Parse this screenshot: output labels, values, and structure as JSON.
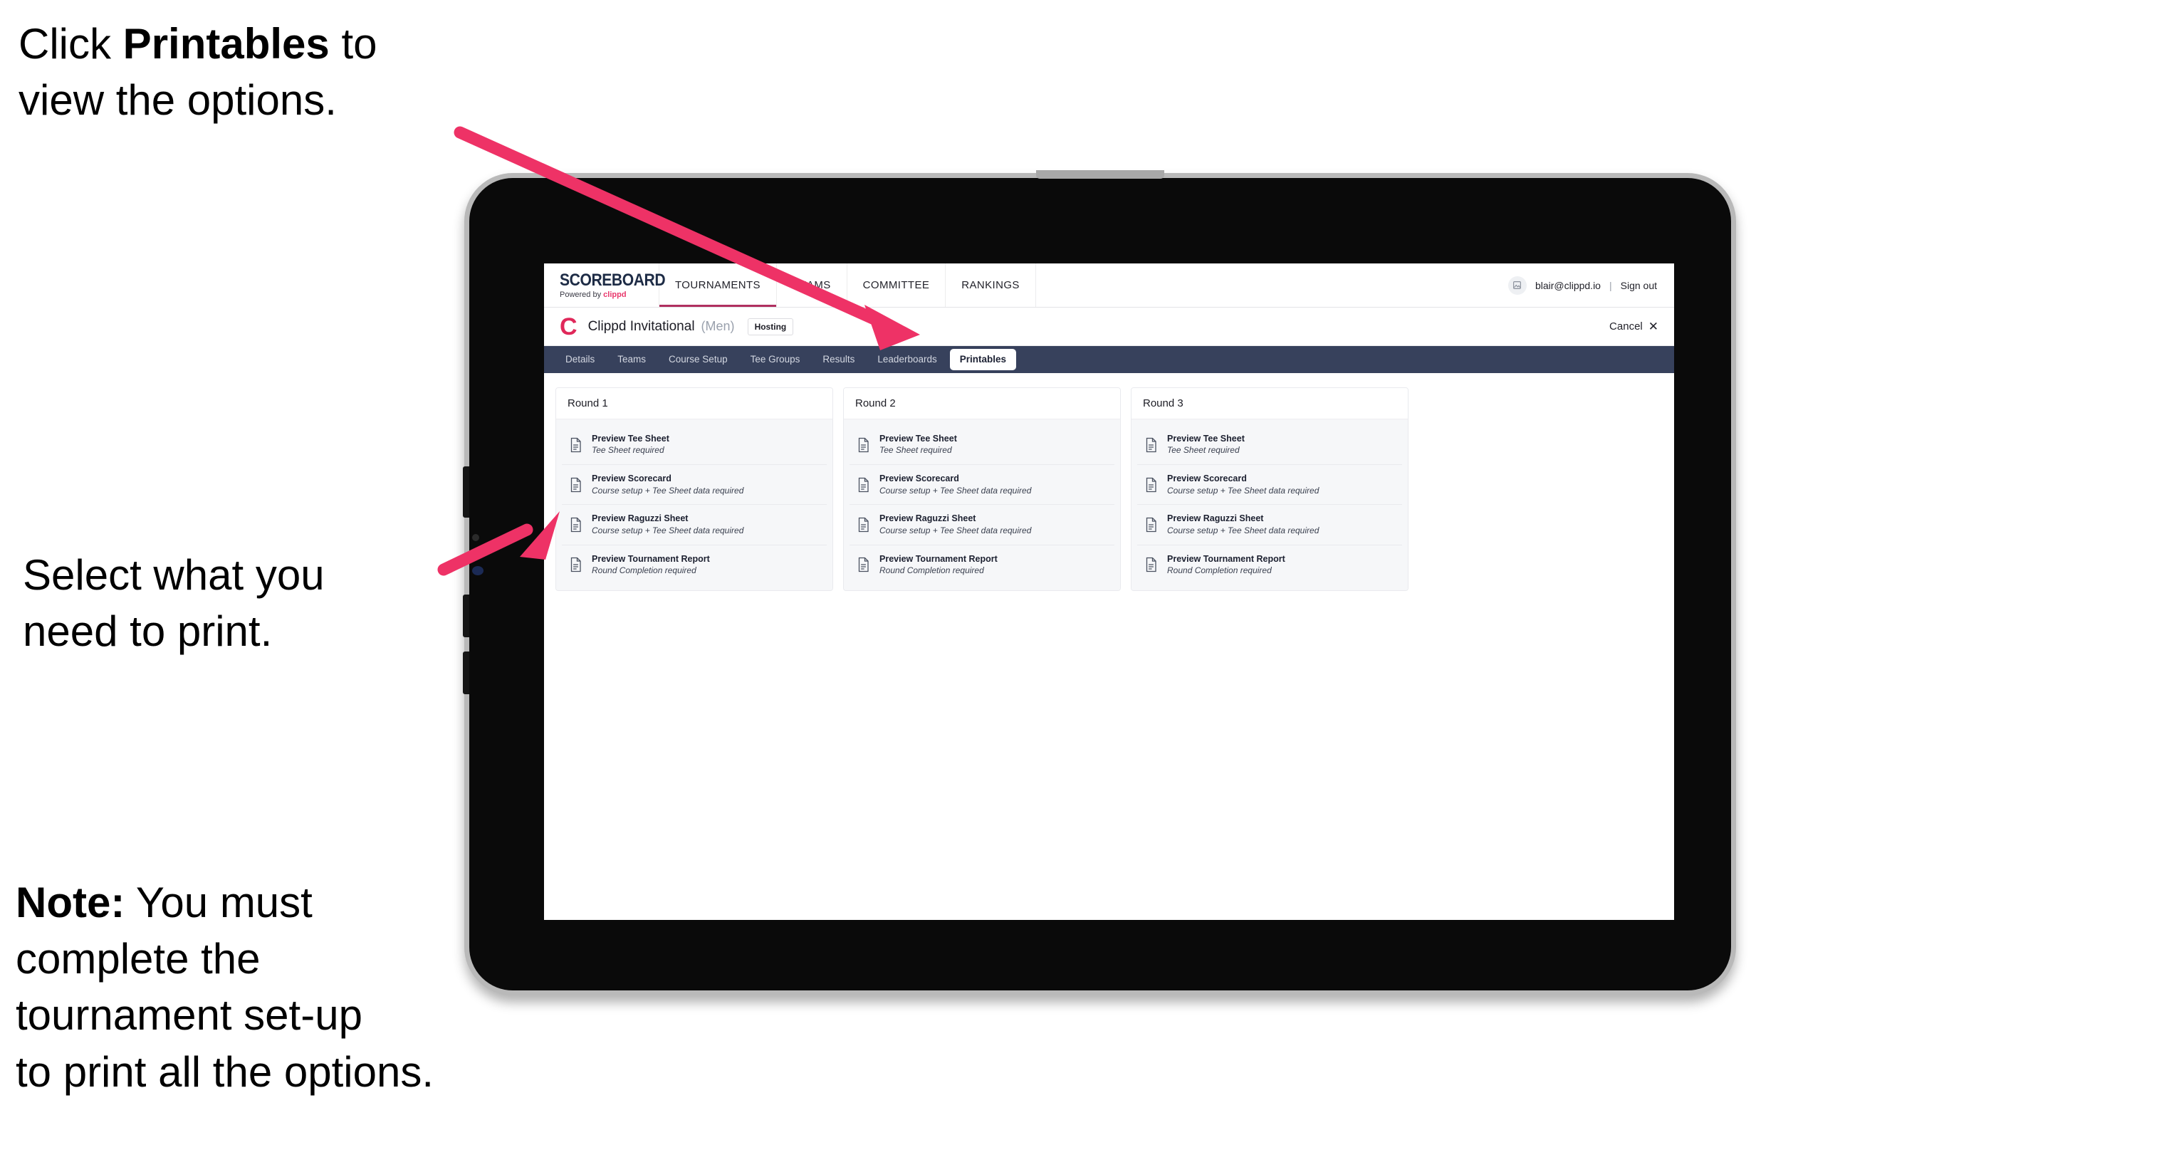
{
  "annotations": {
    "click_printables": "Click Printables to\nview the options.",
    "click_printables_pre": "Click ",
    "click_printables_bold": "Printables",
    "click_printables_post": " to\nview the options.",
    "select_print": "Select what you\n need to print.",
    "note_bold": "Note:",
    "note_rest": " You must\ncomplete the\ntournament set-up\nto print all the options."
  },
  "colors": {
    "arrow_pink": "#EE3266",
    "brand_pink": "#E8376B",
    "clippd_red": "#E0285A",
    "navy": "#1D2B45",
    "subtab_bar": "#37415C",
    "active_underline": "#B03060"
  },
  "topnav": {
    "logo_word": "SCOREBOARD",
    "logo_sub_prefix": "Powered by ",
    "logo_sub_brand": "clippd",
    "items": [
      {
        "label": "TOURNAMENTS",
        "active": true
      },
      {
        "label": "TEAMS",
        "active": false
      },
      {
        "label": "COMMITTEE",
        "active": false
      },
      {
        "label": "RANKINGS",
        "active": false
      }
    ],
    "user": {
      "avatar_icon": "user-avatar-icon",
      "email": "blair@clippd.io",
      "separator": "|",
      "sign_out": "Sign out"
    }
  },
  "tournament_header": {
    "logo_letter": "C",
    "name": "Clippd Invitational",
    "gender": "(Men)",
    "badge": "Hosting",
    "cancel_label": "Cancel",
    "cancel_icon": "close-icon"
  },
  "subtabs": [
    {
      "label": "Details",
      "active": false
    },
    {
      "label": "Teams",
      "active": false
    },
    {
      "label": "Course Setup",
      "active": false
    },
    {
      "label": "Tee Groups",
      "active": false
    },
    {
      "label": "Results",
      "active": false
    },
    {
      "label": "Leaderboards",
      "active": false
    },
    {
      "label": "Printables",
      "active": true
    }
  ],
  "rounds": [
    {
      "title": "Round 1",
      "items": [
        {
          "title": "Preview Tee Sheet",
          "sub": "Tee Sheet required"
        },
        {
          "title": "Preview Scorecard",
          "sub": "Course setup + Tee Sheet data required"
        },
        {
          "title": "Preview Raguzzi Sheet",
          "sub": "Course setup + Tee Sheet data required"
        },
        {
          "title": "Preview Tournament Report",
          "sub": "Round Completion required"
        }
      ]
    },
    {
      "title": "Round 2",
      "items": [
        {
          "title": "Preview Tee Sheet",
          "sub": "Tee Sheet required"
        },
        {
          "title": "Preview Scorecard",
          "sub": "Course setup + Tee Sheet data required"
        },
        {
          "title": "Preview Raguzzi Sheet",
          "sub": "Course setup + Tee Sheet data required"
        },
        {
          "title": "Preview Tournament Report",
          "sub": "Round Completion required"
        }
      ]
    },
    {
      "title": "Round 3",
      "items": [
        {
          "title": "Preview Tee Sheet",
          "sub": "Tee Sheet required"
        },
        {
          "title": "Preview Scorecard",
          "sub": "Course setup + Tee Sheet data required"
        },
        {
          "title": "Preview Raguzzi Sheet",
          "sub": "Course setup + Tee Sheet data required"
        },
        {
          "title": "Preview Tournament Report",
          "sub": "Round Completion required"
        }
      ]
    }
  ]
}
